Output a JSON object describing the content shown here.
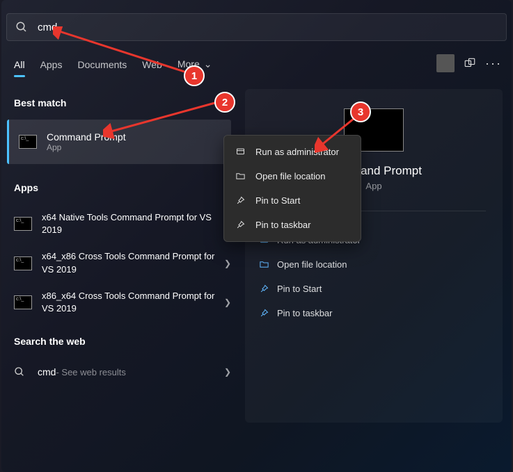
{
  "search": {
    "value": "cmd"
  },
  "tabs": {
    "all": "All",
    "apps": "Apps",
    "documents": "Documents",
    "web": "Web",
    "more": "More"
  },
  "sections": {
    "best_match": "Best match",
    "apps": "Apps",
    "search_web": "Search the web"
  },
  "best_match": {
    "title": "Command Prompt",
    "subtitle": "App"
  },
  "apps_list": [
    {
      "label": "x64 Native Tools Command Prompt for VS 2019"
    },
    {
      "label": "x64_x86 Cross Tools Command Prompt for VS 2019"
    },
    {
      "label": "x86_x64 Cross Tools Command Prompt for VS 2019"
    }
  ],
  "web_result": {
    "query": "cmd",
    "suffix": " - See web results"
  },
  "detail": {
    "title": "Command Prompt",
    "subtitle": "App"
  },
  "actions": {
    "run_admin": "Run as administrator",
    "open_loc": "Open file location",
    "pin_start": "Pin to Start",
    "pin_task": "Pin to taskbar"
  },
  "badges": {
    "b1": "1",
    "b2": "2",
    "b3": "3"
  }
}
